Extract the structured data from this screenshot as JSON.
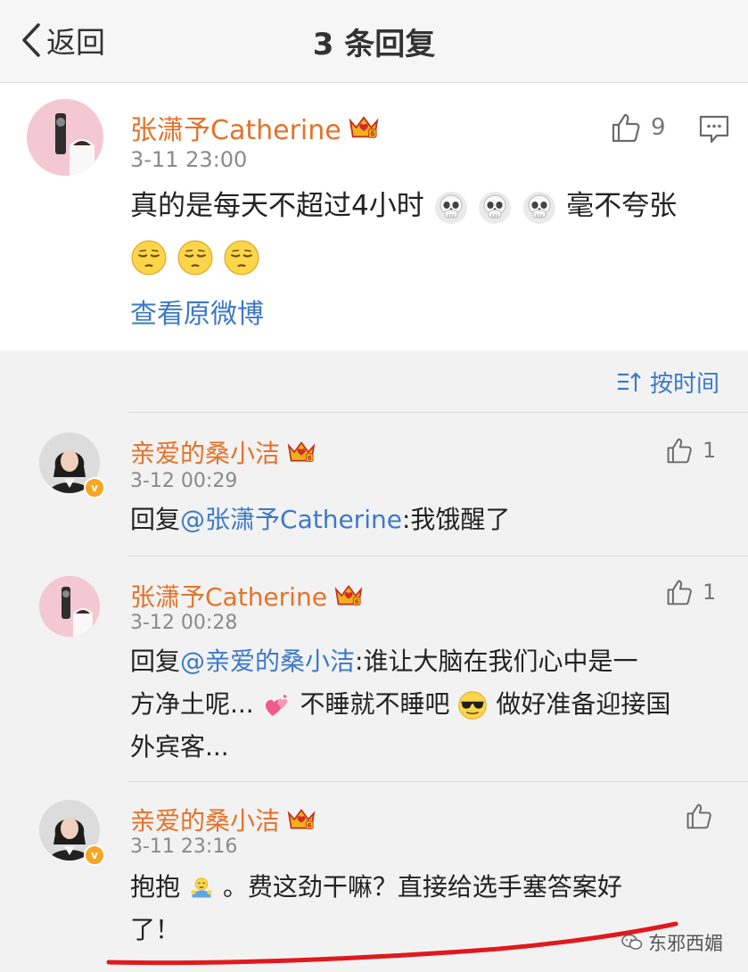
{
  "header": {
    "back_label": "返回",
    "title": "3 条回复"
  },
  "original": {
    "username": "张潇予Catherine",
    "time": "3-11 23:00",
    "likes": "9",
    "text_a": "真的是每天不超过4小时",
    "text_b": "毫不夸张",
    "view_original": "查看原微博"
  },
  "sort": {
    "label": "按时间"
  },
  "replies": [
    {
      "username": "亲爱的桑小洁",
      "time": "3-12 00:29",
      "likes": "1",
      "prefix": "回复",
      "mention": "@张潇予Catherine",
      "text": ":我饿醒了"
    },
    {
      "username": "张潇予Catherine",
      "time": "3-12 00:28",
      "likes": "1",
      "prefix": "回复",
      "mention": "@亲爱的桑小洁",
      "text_a": ":谁让大脑在我们心中是一",
      "text_b": "方净土呢...",
      "text_c": "不睡就不睡吧",
      "text_d": "做好准备迎接国",
      "text_e": "外宾客..."
    },
    {
      "username": "亲爱的桑小洁",
      "time": "3-11 23:16",
      "text_a": "抱抱",
      "text_b": "。费这劲干嘛？直接给选手塞答案好",
      "text_c": "了！"
    }
  ],
  "watermark": "东邪西媚",
  "colors": {
    "username": "#e4722a",
    "link": "#3b79c5",
    "mention": "#3c79c7",
    "background": "#f2f2f2",
    "underline_annotation": "#e0191f"
  }
}
